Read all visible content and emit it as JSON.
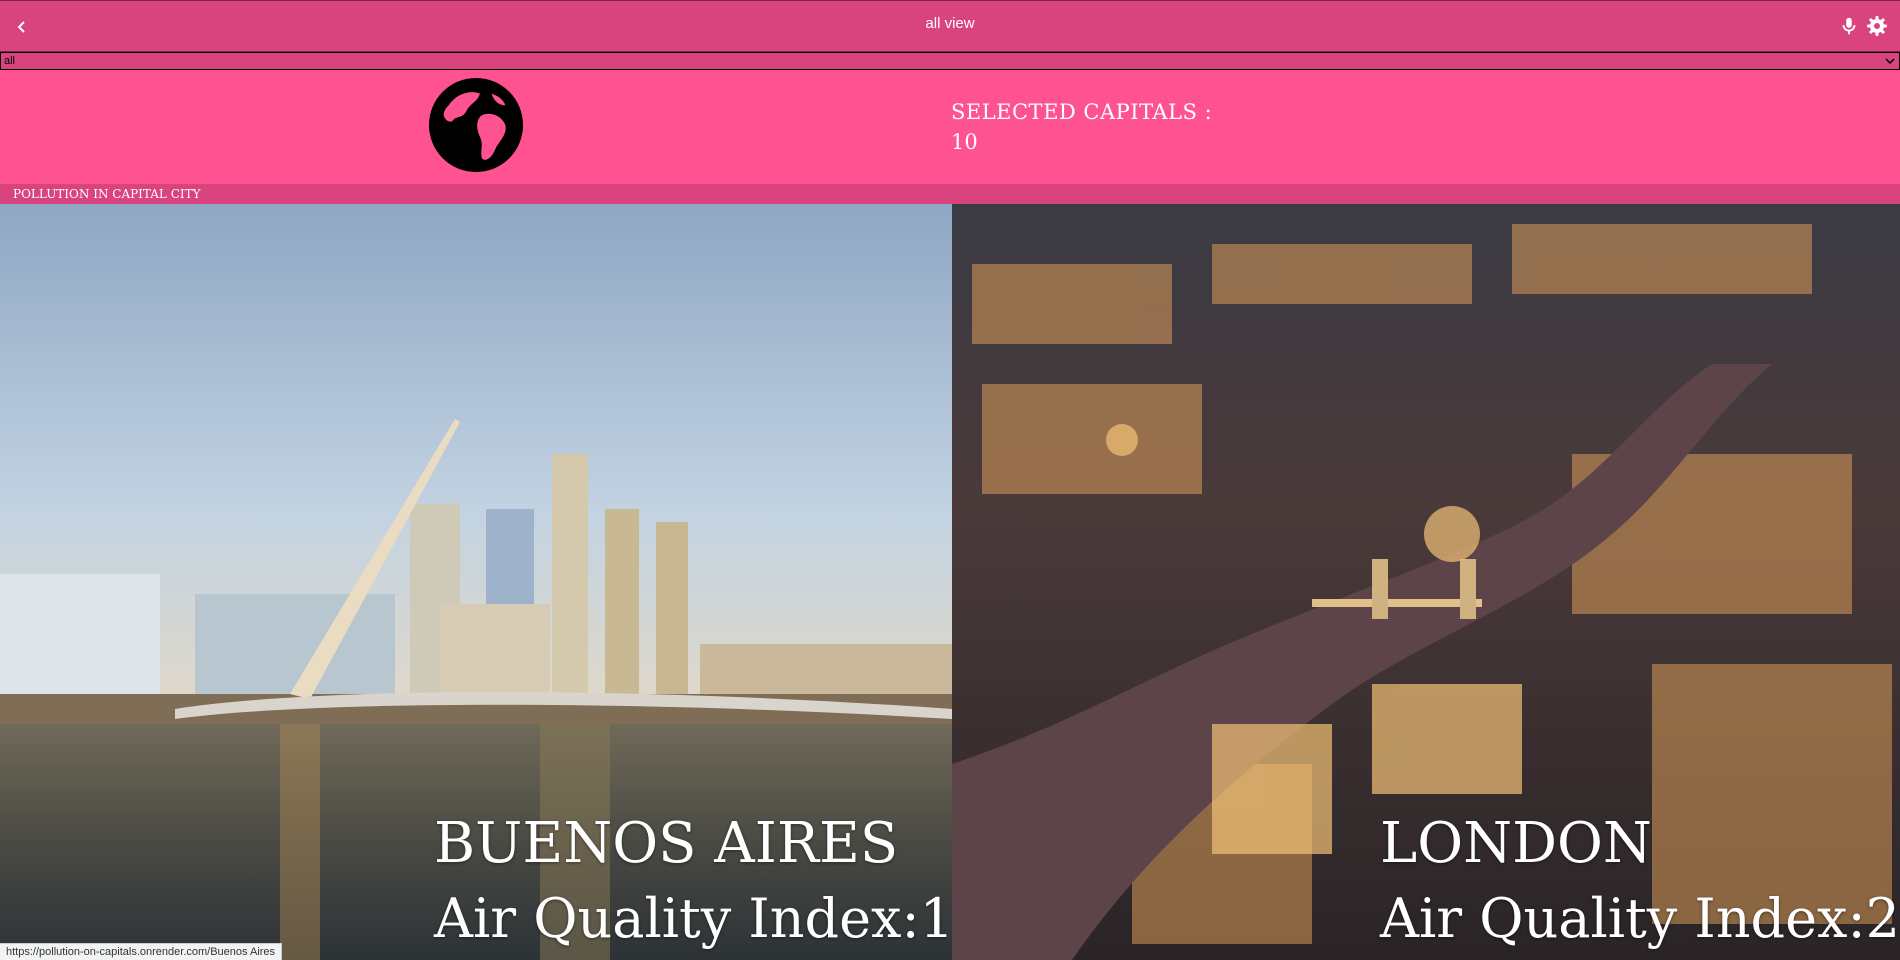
{
  "appbar": {
    "title": "all view",
    "icons": {
      "back": "chevron-left-icon",
      "mic": "microphone-icon",
      "settings": "gear-icon"
    }
  },
  "filter": {
    "selected": "all"
  },
  "header": {
    "icon": "globe-icon",
    "selected_label": "SELECTED CAPITALS :",
    "selected_count": "10"
  },
  "section": {
    "label": "POLLUTION IN CAPITAL CITY"
  },
  "cards": [
    {
      "city": "BUENOS AIRES",
      "aqi_text": "Air Quality Index:1"
    },
    {
      "city": "LONDON",
      "aqi_text": "Air Quality Index:2"
    }
  ],
  "status": {
    "url": "https://pollution-on-capitals.onrender.com/Buenos Aires"
  },
  "colors": {
    "appbar": "#d9447e",
    "header": "#ff5290",
    "text": "#ffffff"
  }
}
